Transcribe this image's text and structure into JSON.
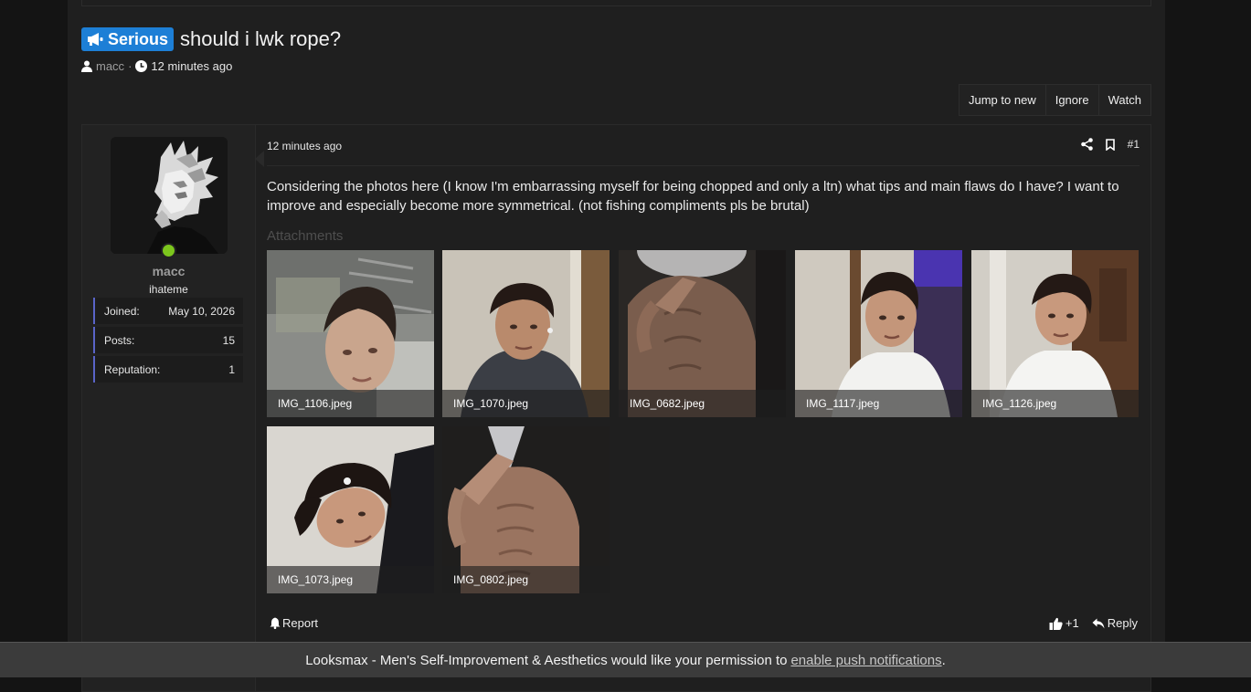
{
  "thread": {
    "prefix": "Serious",
    "title": "should i lwk rope?",
    "author": "macc",
    "separator": "·",
    "time": "12 minutes ago"
  },
  "thread_buttons": {
    "jump_to_new": "Jump to new",
    "ignore": "Ignore",
    "watch": "Watch"
  },
  "user": {
    "name": "macc",
    "title": "ihateme",
    "stats": [
      {
        "label": "Joined:",
        "value": "May 10, 2026"
      },
      {
        "label": "Posts:",
        "value": "15"
      },
      {
        "label": "Reputation:",
        "value": "1"
      }
    ]
  },
  "post": {
    "time": "12 minutes ago",
    "number": "#1",
    "body": "Considering the photos here (I know I'm embarrassing myself for being chopped and only a ltn) what tips and main flaws do I have? I want to improve and especially become more symmetrical. (not fishing compliments pls be brutal)",
    "attachments_label": "Attachments",
    "attachments": [
      {
        "name": "IMG_1106.jpeg"
      },
      {
        "name": "IMG_1070.jpeg"
      },
      {
        "name": "IMG_0682.jpeg"
      },
      {
        "name": "IMG_1117.jpeg"
      },
      {
        "name": "IMG_1126.jpeg"
      },
      {
        "name": "IMG_1073.jpeg"
      },
      {
        "name": "IMG_0802.jpeg"
      }
    ],
    "report": "Report",
    "reaction_count": "+1",
    "reply": "Reply"
  },
  "notification": {
    "text": "Looksmax - Men's Self-Improvement & Aesthetics would like your permission to",
    "link": "enable push notifications",
    "end": "."
  },
  "colors": {
    "prefix_bg": "#1d7fd6",
    "online": "#7cc61d",
    "stat_accent": "#5a64c8"
  },
  "icons": {
    "prefix": "megaphone-icon",
    "author": "user-icon",
    "time": "clock-icon",
    "share": "share-icon",
    "bookmark": "bookmark-icon",
    "report": "bell-icon",
    "like": "thumbs-up-icon",
    "reply": "reply-icon"
  }
}
